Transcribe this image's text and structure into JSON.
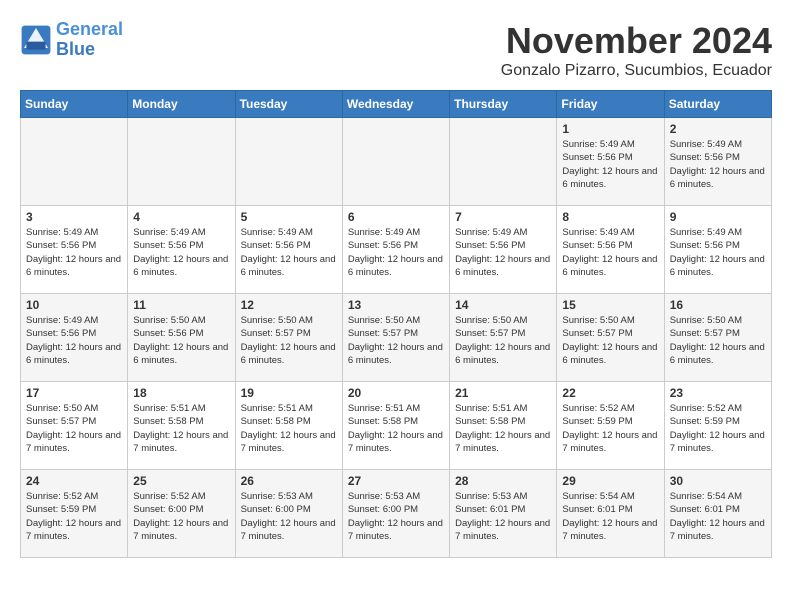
{
  "logo": {
    "text_general": "General",
    "text_blue": "Blue"
  },
  "title": {
    "month_year": "November 2024",
    "location": "Gonzalo Pizarro, Sucumbios, Ecuador"
  },
  "header": {
    "days": [
      "Sunday",
      "Monday",
      "Tuesday",
      "Wednesday",
      "Thursday",
      "Friday",
      "Saturday"
    ]
  },
  "weeks": [
    {
      "days": [
        {
          "num": "",
          "info": ""
        },
        {
          "num": "",
          "info": ""
        },
        {
          "num": "",
          "info": ""
        },
        {
          "num": "",
          "info": ""
        },
        {
          "num": "",
          "info": ""
        },
        {
          "num": "1",
          "info": "Sunrise: 5:49 AM\nSunset: 5:56 PM\nDaylight: 12 hours and 6 minutes."
        },
        {
          "num": "2",
          "info": "Sunrise: 5:49 AM\nSunset: 5:56 PM\nDaylight: 12 hours and 6 minutes."
        }
      ]
    },
    {
      "days": [
        {
          "num": "3",
          "info": "Sunrise: 5:49 AM\nSunset: 5:56 PM\nDaylight: 12 hours and 6 minutes."
        },
        {
          "num": "4",
          "info": "Sunrise: 5:49 AM\nSunset: 5:56 PM\nDaylight: 12 hours and 6 minutes."
        },
        {
          "num": "5",
          "info": "Sunrise: 5:49 AM\nSunset: 5:56 PM\nDaylight: 12 hours and 6 minutes."
        },
        {
          "num": "6",
          "info": "Sunrise: 5:49 AM\nSunset: 5:56 PM\nDaylight: 12 hours and 6 minutes."
        },
        {
          "num": "7",
          "info": "Sunrise: 5:49 AM\nSunset: 5:56 PM\nDaylight: 12 hours and 6 minutes."
        },
        {
          "num": "8",
          "info": "Sunrise: 5:49 AM\nSunset: 5:56 PM\nDaylight: 12 hours and 6 minutes."
        },
        {
          "num": "9",
          "info": "Sunrise: 5:49 AM\nSunset: 5:56 PM\nDaylight: 12 hours and 6 minutes."
        }
      ]
    },
    {
      "days": [
        {
          "num": "10",
          "info": "Sunrise: 5:49 AM\nSunset: 5:56 PM\nDaylight: 12 hours and 6 minutes."
        },
        {
          "num": "11",
          "info": "Sunrise: 5:50 AM\nSunset: 5:56 PM\nDaylight: 12 hours and 6 minutes."
        },
        {
          "num": "12",
          "info": "Sunrise: 5:50 AM\nSunset: 5:57 PM\nDaylight: 12 hours and 6 minutes."
        },
        {
          "num": "13",
          "info": "Sunrise: 5:50 AM\nSunset: 5:57 PM\nDaylight: 12 hours and 6 minutes."
        },
        {
          "num": "14",
          "info": "Sunrise: 5:50 AM\nSunset: 5:57 PM\nDaylight: 12 hours and 6 minutes."
        },
        {
          "num": "15",
          "info": "Sunrise: 5:50 AM\nSunset: 5:57 PM\nDaylight: 12 hours and 6 minutes."
        },
        {
          "num": "16",
          "info": "Sunrise: 5:50 AM\nSunset: 5:57 PM\nDaylight: 12 hours and 6 minutes."
        }
      ]
    },
    {
      "days": [
        {
          "num": "17",
          "info": "Sunrise: 5:50 AM\nSunset: 5:57 PM\nDaylight: 12 hours and 7 minutes."
        },
        {
          "num": "18",
          "info": "Sunrise: 5:51 AM\nSunset: 5:58 PM\nDaylight: 12 hours and 7 minutes."
        },
        {
          "num": "19",
          "info": "Sunrise: 5:51 AM\nSunset: 5:58 PM\nDaylight: 12 hours and 7 minutes."
        },
        {
          "num": "20",
          "info": "Sunrise: 5:51 AM\nSunset: 5:58 PM\nDaylight: 12 hours and 7 minutes."
        },
        {
          "num": "21",
          "info": "Sunrise: 5:51 AM\nSunset: 5:58 PM\nDaylight: 12 hours and 7 minutes."
        },
        {
          "num": "22",
          "info": "Sunrise: 5:52 AM\nSunset: 5:59 PM\nDaylight: 12 hours and 7 minutes."
        },
        {
          "num": "23",
          "info": "Sunrise: 5:52 AM\nSunset: 5:59 PM\nDaylight: 12 hours and 7 minutes."
        }
      ]
    },
    {
      "days": [
        {
          "num": "24",
          "info": "Sunrise: 5:52 AM\nSunset: 5:59 PM\nDaylight: 12 hours and 7 minutes."
        },
        {
          "num": "25",
          "info": "Sunrise: 5:52 AM\nSunset: 6:00 PM\nDaylight: 12 hours and 7 minutes."
        },
        {
          "num": "26",
          "info": "Sunrise: 5:53 AM\nSunset: 6:00 PM\nDaylight: 12 hours and 7 minutes."
        },
        {
          "num": "27",
          "info": "Sunrise: 5:53 AM\nSunset: 6:00 PM\nDaylight: 12 hours and 7 minutes."
        },
        {
          "num": "28",
          "info": "Sunrise: 5:53 AM\nSunset: 6:01 PM\nDaylight: 12 hours and 7 minutes."
        },
        {
          "num": "29",
          "info": "Sunrise: 5:54 AM\nSunset: 6:01 PM\nDaylight: 12 hours and 7 minutes."
        },
        {
          "num": "30",
          "info": "Sunrise: 5:54 AM\nSunset: 6:01 PM\nDaylight: 12 hours and 7 minutes."
        }
      ]
    }
  ]
}
